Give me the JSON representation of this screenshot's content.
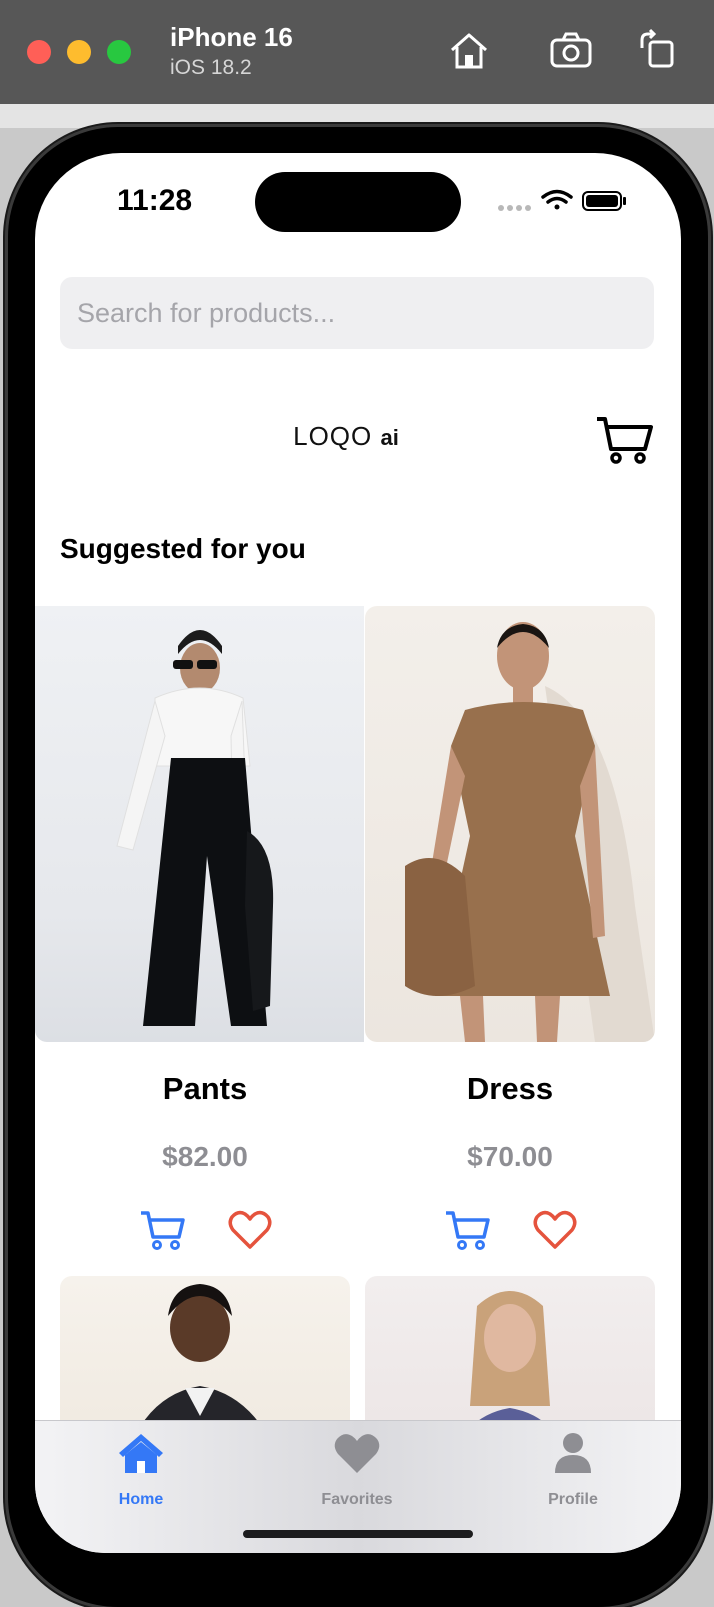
{
  "window": {
    "device_name": "iPhone 16",
    "os_version": "iOS 18.2"
  },
  "status_bar": {
    "time": "11:28"
  },
  "search": {
    "placeholder": "Search for products...",
    "value": ""
  },
  "header": {
    "logo_text": "LOQO",
    "logo_suffix": "ai"
  },
  "section": {
    "title": "Suggested for you"
  },
  "products": [
    {
      "name": "Pants",
      "price": "$82.00"
    },
    {
      "name": "Dress",
      "price": "$70.00"
    }
  ],
  "tabbar": {
    "items": [
      {
        "label": "Home",
        "active": true
      },
      {
        "label": "Favorites",
        "active": false
      },
      {
        "label": "Profile",
        "active": false
      }
    ]
  },
  "colors": {
    "accent": "#3478f6",
    "heart": "#e5533d",
    "price": "#8e8e93",
    "search_bg": "#efeff1"
  }
}
